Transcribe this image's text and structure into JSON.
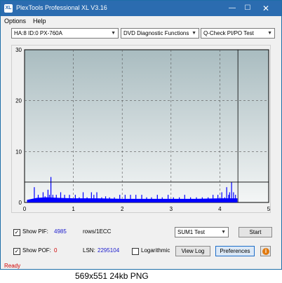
{
  "window": {
    "title": "PlexTools Professional XL V3.16",
    "icon_text": "XL",
    "minimize": "—",
    "maximize": "☐",
    "close": "✕"
  },
  "menu": {
    "options": "Options",
    "help": "Help"
  },
  "toolbar": {
    "drive": "HA:8 ID:0  PX-760A",
    "function": "DVD Diagnostic Functions",
    "test": "Q-Check PI/PO Test"
  },
  "chart_data": {
    "type": "bar",
    "x_ticks": [
      "0",
      "1",
      "2",
      "3",
      "4",
      "5"
    ],
    "y_ticks": [
      "0",
      "10",
      "20",
      "30"
    ],
    "xlim": [
      0,
      5
    ],
    "ylim": [
      0,
      30
    ],
    "threshold": 4,
    "end_marker": 4.37,
    "grid": true,
    "series_color": "#0000ff",
    "spikes": [
      {
        "x": 0.2,
        "y": 3
      },
      {
        "x": 0.28,
        "y": 1.5
      },
      {
        "x": 0.38,
        "y": 2
      },
      {
        "x": 0.42,
        "y": 1.2
      },
      {
        "x": 0.48,
        "y": 2.5
      },
      {
        "x": 0.51,
        "y": 1.5
      },
      {
        "x": 0.54,
        "y": 5
      },
      {
        "x": 0.58,
        "y": 1.5
      },
      {
        "x": 0.65,
        "y": 1.5
      },
      {
        "x": 0.74,
        "y": 2
      },
      {
        "x": 0.82,
        "y": 1.5
      },
      {
        "x": 0.92,
        "y": 1.5
      },
      {
        "x": 1.04,
        "y": 1.5
      },
      {
        "x": 1.12,
        "y": 1
      },
      {
        "x": 1.2,
        "y": 2
      },
      {
        "x": 1.28,
        "y": 1
      },
      {
        "x": 1.37,
        "y": 2
      },
      {
        "x": 1.42,
        "y": 1.5
      },
      {
        "x": 1.48,
        "y": 2
      },
      {
        "x": 1.58,
        "y": 1
      },
      {
        "x": 1.66,
        "y": 1.2
      },
      {
        "x": 1.74,
        "y": 1
      },
      {
        "x": 1.84,
        "y": 1
      },
      {
        "x": 1.95,
        "y": 1.5
      },
      {
        "x": 2.06,
        "y": 1.5
      },
      {
        "x": 2.17,
        "y": 1.5
      },
      {
        "x": 2.28,
        "y": 1.5
      },
      {
        "x": 2.4,
        "y": 1.5
      },
      {
        "x": 2.5,
        "y": 1
      },
      {
        "x": 2.6,
        "y": 1
      },
      {
        "x": 2.72,
        "y": 1.5
      },
      {
        "x": 2.82,
        "y": 1
      },
      {
        "x": 2.94,
        "y": 1.5
      },
      {
        "x": 3.05,
        "y": 1
      },
      {
        "x": 3.17,
        "y": 1
      },
      {
        "x": 3.28,
        "y": 1.5
      },
      {
        "x": 3.4,
        "y": 1
      },
      {
        "x": 3.52,
        "y": 1
      },
      {
        "x": 3.64,
        "y": 1
      },
      {
        "x": 3.76,
        "y": 1
      },
      {
        "x": 3.86,
        "y": 1.5
      },
      {
        "x": 3.96,
        "y": 1.5
      },
      {
        "x": 4.04,
        "y": 2
      },
      {
        "x": 4.1,
        "y": 1
      },
      {
        "x": 4.14,
        "y": 3
      },
      {
        "x": 4.18,
        "y": 1.5
      },
      {
        "x": 4.2,
        "y": 2
      },
      {
        "x": 4.24,
        "y": 4
      },
      {
        "x": 4.28,
        "y": 2
      },
      {
        "x": 4.32,
        "y": 1.5
      }
    ],
    "baseline": [
      {
        "x": 0.05,
        "y": 0.5
      },
      {
        "x": 0.25,
        "y": 0.9
      },
      {
        "x": 0.45,
        "y": 1.0
      },
      {
        "x": 0.7,
        "y": 0.9
      },
      {
        "x": 1.0,
        "y": 0.8
      },
      {
        "x": 1.5,
        "y": 0.8
      },
      {
        "x": 2.0,
        "y": 0.7
      },
      {
        "x": 2.5,
        "y": 0.7
      },
      {
        "x": 3.0,
        "y": 0.7
      },
      {
        "x": 3.5,
        "y": 0.7
      },
      {
        "x": 4.0,
        "y": 0.8
      },
      {
        "x": 4.36,
        "y": 0.8
      }
    ]
  },
  "pif": {
    "label": "Show PIF:",
    "checked": "✓",
    "value": "4985",
    "unit": "rows/1ECC"
  },
  "pof": {
    "label": "Show POF:",
    "checked": "✓",
    "value": "0",
    "lsn_label": "LSN:",
    "lsn_value": "2295104",
    "log_label": "Logarithmic"
  },
  "controls": {
    "sum_test": "SUM1 Test",
    "start": "Start",
    "view_log": "View Log",
    "preferences": "Preferences",
    "info": "i"
  },
  "status": "Ready",
  "caption": "569x551 24kb PNG"
}
